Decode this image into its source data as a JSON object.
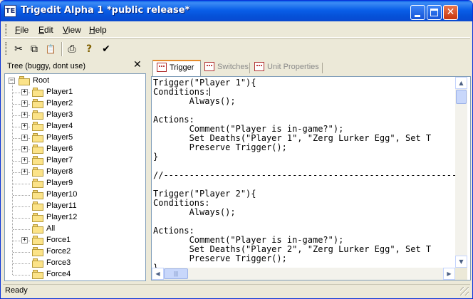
{
  "window": {
    "title": "Trigedit Alpha 1 *public release*",
    "app_icon": "TE",
    "close_glyph": "✕"
  },
  "menu": {
    "items": [
      {
        "label": "File",
        "accel": "F",
        "rest": "ile"
      },
      {
        "label": "Edit",
        "accel": "E",
        "rest": "dit"
      },
      {
        "label": "View",
        "accel": "V",
        "rest": "iew"
      },
      {
        "label": "Help",
        "accel": "H",
        "rest": "elp"
      }
    ]
  },
  "toolbar": {
    "cut_glyph": "✂",
    "copy_glyph": "⧉",
    "paste_glyph": "📋",
    "print_glyph": "⎙",
    "help_glyph": "?",
    "check_glyph": "✔"
  },
  "tree": {
    "title": "Tree (buggy, dont use)",
    "close_glyph": "✕",
    "root": "Root",
    "nodes": [
      {
        "label": "Player1",
        "expandable": true
      },
      {
        "label": "Player2",
        "expandable": true
      },
      {
        "label": "Player3",
        "expandable": true
      },
      {
        "label": "Player4",
        "expandable": true
      },
      {
        "label": "Player5",
        "expandable": true
      },
      {
        "label": "Player6",
        "expandable": true
      },
      {
        "label": "Player7",
        "expandable": true
      },
      {
        "label": "Player8",
        "expandable": true
      },
      {
        "label": "Player9",
        "expandable": false
      },
      {
        "label": "Player10",
        "expandable": false
      },
      {
        "label": "Player11",
        "expandable": false
      },
      {
        "label": "Player12",
        "expandable": false
      },
      {
        "label": "All",
        "expandable": false
      },
      {
        "label": "Force1",
        "expandable": true
      },
      {
        "label": "Force2",
        "expandable": false
      },
      {
        "label": "Force3",
        "expandable": false
      },
      {
        "label": "Force4",
        "expandable": false
      }
    ]
  },
  "tabs": [
    {
      "label": "Trigger",
      "active": true
    },
    {
      "label": "Switches",
      "active": false
    },
    {
      "label": "Unit Properties",
      "active": false
    }
  ],
  "editor": {
    "lines": [
      "Trigger(\"Player 1\"){",
      "Conditions:",
      "\tAlways();",
      "",
      "Actions:",
      "\tComment(\"Player is in-game?\");",
      "\tSet Deaths(\"Player 1\", \"Zerg Lurker Egg\", Set T",
      "\tPreserve Trigger();",
      "}",
      "",
      "//-----------------------------------------------------------------",
      "",
      "Trigger(\"Player 2\"){",
      "Conditions:",
      "\tAlways();",
      "",
      "Actions:",
      "\tComment(\"Player is in-game?\");",
      "\tSet Deaths(\"Player 2\", \"Zerg Lurker Egg\", Set T",
      "\tPreserve Trigger();",
      "}"
    ],
    "scroll_up": "▲",
    "scroll_down": "▼",
    "scroll_left": "◀",
    "scroll_right": "▶",
    "thumb_grip": "|||"
  },
  "status": {
    "text": "Ready"
  }
}
